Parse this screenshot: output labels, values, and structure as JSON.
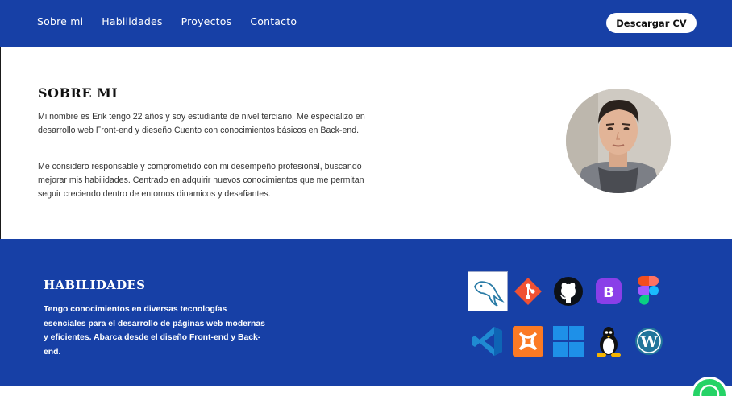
{
  "nav": {
    "items": [
      "Sobre mi",
      "Habilidades",
      "Proyectos",
      "Contacto"
    ],
    "cv_label": "Descargar CV"
  },
  "about": {
    "title": "SOBRE MI",
    "paragraph1": "Mi nombre es Erik tengo 22 años y soy estudiante de nivel terciario. Me especializo en desarrollo web Front-end y dieseño.Cuento con conocimientos básicos en Back-end.",
    "paragraph2": "Me considero responsable y comprometido con mi desempeño profesional, buscando mejorar mis habilidades. Centrado en adquirir nuevos conocimientos que me permitan seguir creciendo dentro de entornos dinamicos y desafiantes."
  },
  "skills": {
    "title": "HABILIDADES",
    "description": "Tengo conocimientos en diversas tecnologías esenciales para el desarrollo de páginas web modernas y eficientes. Abarca desde el diseño Front-end y Back-end.",
    "icons": [
      "mysql-icon",
      "git-icon",
      "github-icon",
      "bootstrap-icon",
      "figma-icon",
      "vscode-icon",
      "xampp-icon",
      "windows-icon",
      "linux-icon",
      "wordpress-icon"
    ],
    "bootstrap_letter": "B"
  },
  "colors": {
    "primary": "#1740a6",
    "white": "#ffffff",
    "whatsapp": "#25d366"
  }
}
